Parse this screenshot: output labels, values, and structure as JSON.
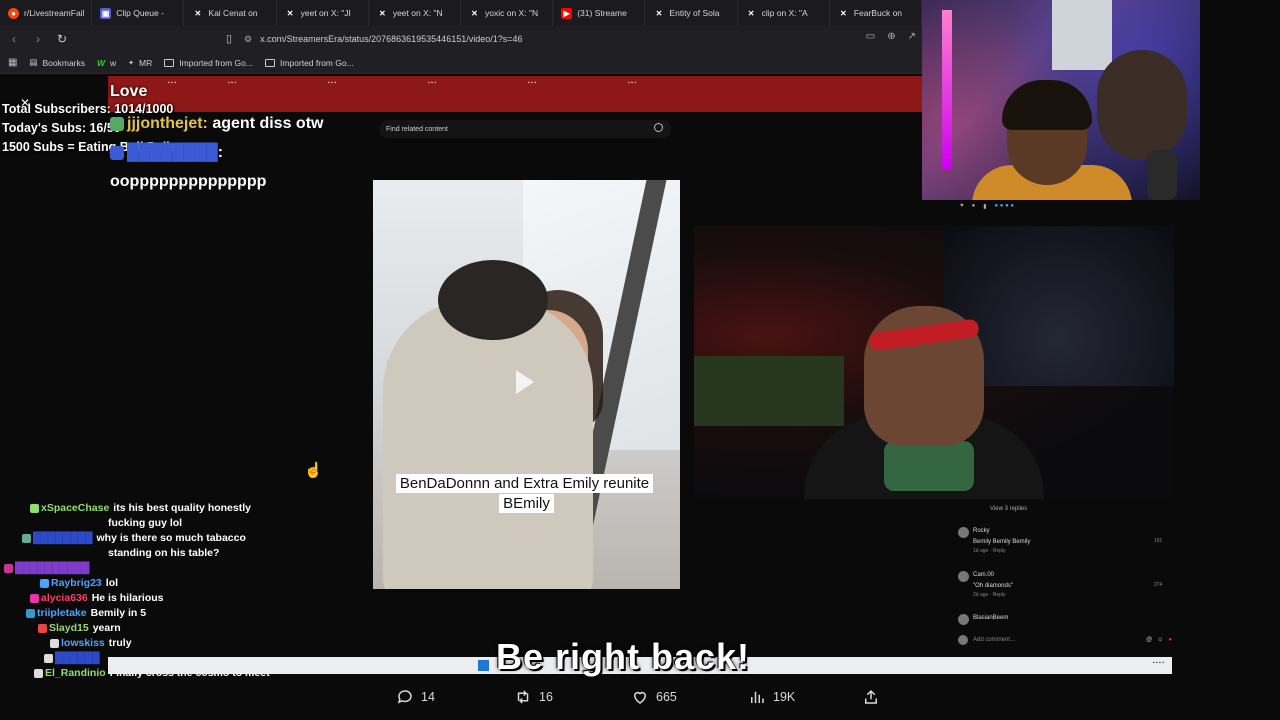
{
  "tabs": [
    {
      "label": "r/LivestreamFail",
      "icon": "reddit-icon",
      "color": "#ff4500"
    },
    {
      "label": "Clip Queue -",
      "icon": "clipqueue-icon",
      "color": "#5a5fd6"
    },
    {
      "label": "Kai Cenat on",
      "icon": "x-icon",
      "color": "#444444"
    },
    {
      "label": "yeet on X: \"JI",
      "icon": "x-icon",
      "color": "#444444"
    },
    {
      "label": "yeet on X: \"N",
      "icon": "x-icon",
      "color": "#444444"
    },
    {
      "label": "yoxic on X: \"N",
      "icon": "x-icon",
      "color": "#444444"
    },
    {
      "label": "(31) Streame",
      "icon": "youtube-icon",
      "color": "#ff0000"
    },
    {
      "label": "Entity of Sola",
      "icon": "x-icon",
      "color": "#444444"
    },
    {
      "label": "clip on X: \"A",
      "icon": "x-icon",
      "color": "#444444"
    },
    {
      "label": "FearBuck on",
      "icon": "x-icon",
      "color": "#444444"
    }
  ],
  "address": {
    "url": "x.com/StreamersEra/status/2076863619535446151/video/1?s=46"
  },
  "bookmarks": [
    {
      "label": "Bookmarks",
      "icon": "bookmarks-icon"
    },
    {
      "label": "w",
      "icon": "w-icon"
    },
    {
      "label": "MR",
      "icon": "mr-icon"
    },
    {
      "label": "Imported from Go...",
      "icon": "folder-icon"
    },
    {
      "label": "Imported from Go...",
      "icon": "folder-icon"
    }
  ],
  "stream_overlay": {
    "love": "Love",
    "total_subs": "Total Subscribers: 1014/1000",
    "today_subs": "Today's Subs: 16/50",
    "goal": "1500 Subs = Eating Bull Balls"
  },
  "big_chat": [
    {
      "user": "jjjonthejet:",
      "message": "agent diss otw"
    },
    {
      "user": "",
      "message": "oopppppppppppppp"
    }
  ],
  "related_search": {
    "placeholder": "Find related content"
  },
  "video_caption": "BenDaDonnn and Extra Emily reunite BEmily",
  "right_panel": {
    "view_replies": "View 3 replies",
    "comments": [
      {
        "user": "Rocky",
        "text": "Bemily Bemily Bemily",
        "meta": "1d ago · Reply",
        "likes": "191"
      },
      {
        "user": "Cam.00",
        "text": "\"Oh diamonds\"",
        "meta": "2d ago · Reply",
        "likes": "274"
      },
      {
        "user": "BlasianBeem",
        "text": "",
        "meta": "",
        "likes": ""
      }
    ],
    "add_comment": "Add comment..."
  },
  "small_chat": [
    {
      "user": "xSpaceChase",
      "message": "its his best quality honestly",
      "user_color": "#8fe06a"
    },
    {
      "user": "",
      "message": "fucking guy lol",
      "user_color": "#ffffff"
    },
    {
      "user": "",
      "message": "why is there so much tabacco",
      "user_color": "#2b49c9"
    },
    {
      "user": "",
      "message": "standing on his table?",
      "user_color": "#ffffff"
    },
    {
      "user": "Raybrig23",
      "message": "lol",
      "user_color": "#4aa3ff"
    },
    {
      "user": "alycia636",
      "message": "He is hilarious",
      "user_color": "#ff3b6b"
    },
    {
      "user": "triipletake",
      "message": "Bemily in 5",
      "user_color": "#4aa3ff"
    },
    {
      "user": "Slayd15",
      "message": "yearn",
      "user_color": "#9ad86a"
    },
    {
      "user": "lowskiss",
      "message": "truly",
      "user_color": "#4aa3ff"
    },
    {
      "user": "El_Randinio",
      "message": "Finally cross the cosmo to meet",
      "user_color": "#8fe06a"
    }
  ],
  "brb": "Be right back!",
  "tweet_actions": {
    "replies": "14",
    "reposts": "16",
    "likes": "665",
    "views": "19K"
  }
}
